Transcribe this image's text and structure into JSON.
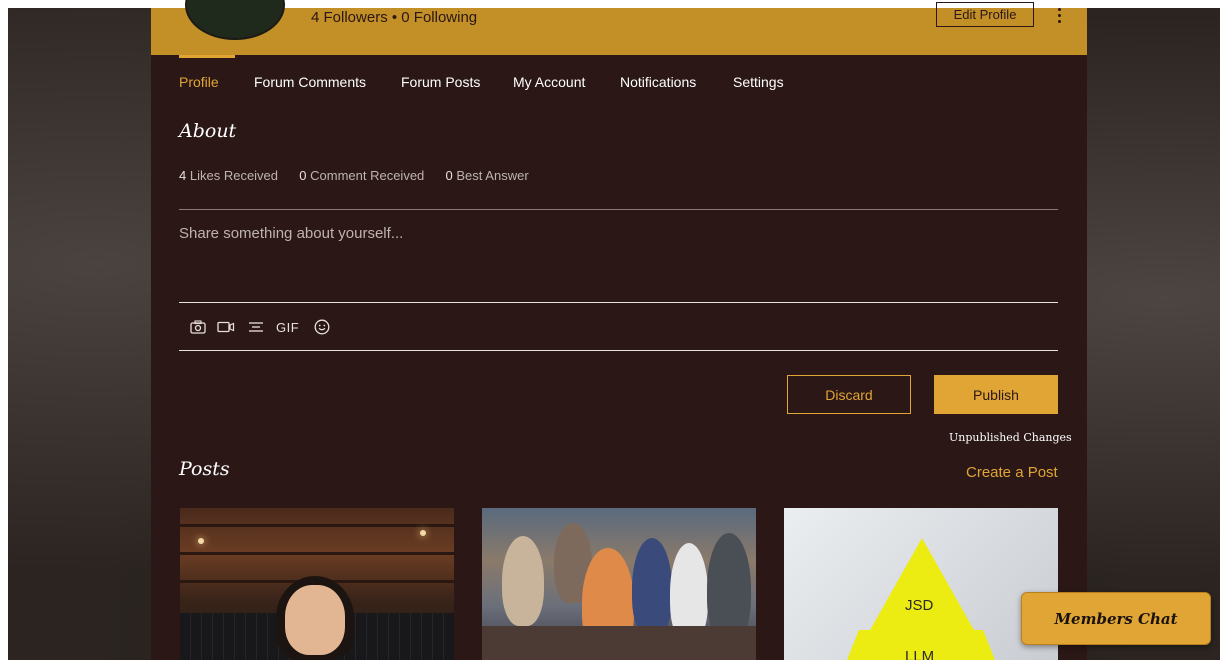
{
  "header": {
    "followers_text": "4 Followers • 0 Following",
    "edit_profile_label": "Edit Profile"
  },
  "tabs": [
    {
      "label": "Profile",
      "active": true
    },
    {
      "label": "Forum Comments",
      "active": false
    },
    {
      "label": "Forum Posts",
      "active": false
    },
    {
      "label": "My Account",
      "active": false
    },
    {
      "label": "Notifications",
      "active": false
    },
    {
      "label": "Settings",
      "active": false
    }
  ],
  "about": {
    "title": "About",
    "stats": {
      "likes_count": "4",
      "likes_label": "Likes Received",
      "comments_count": "0",
      "comments_label": "Comment Received",
      "answers_count": "0",
      "answers_label": "Best Answer"
    },
    "share_placeholder": "Share something about yourself...",
    "toolbar": {
      "icons": [
        "camera-icon",
        "video-icon",
        "divider-icon",
        "gif-icon",
        "emoji-icon"
      ],
      "gif_label": "GIF"
    },
    "discard_label": "Discard",
    "publish_label": "Publish",
    "unpublished_label": "Unpublished Changes"
  },
  "posts": {
    "title": "Posts",
    "create_label": "Create a Post",
    "cards": [
      {
        "image": "woman-in-cafe"
      },
      {
        "image": "congregation-with-masks"
      },
      {
        "image": "pyramid-diagram",
        "labels": [
          "JSD",
          "LLM"
        ]
      }
    ]
  },
  "chat": {
    "label": "Members Chat"
  },
  "colors": {
    "accent": "#e0a534",
    "header_gold": "#c38f27",
    "panel_bg": "#2a1716",
    "text": "#ffffff",
    "muted_text": "#bfb3ae"
  }
}
